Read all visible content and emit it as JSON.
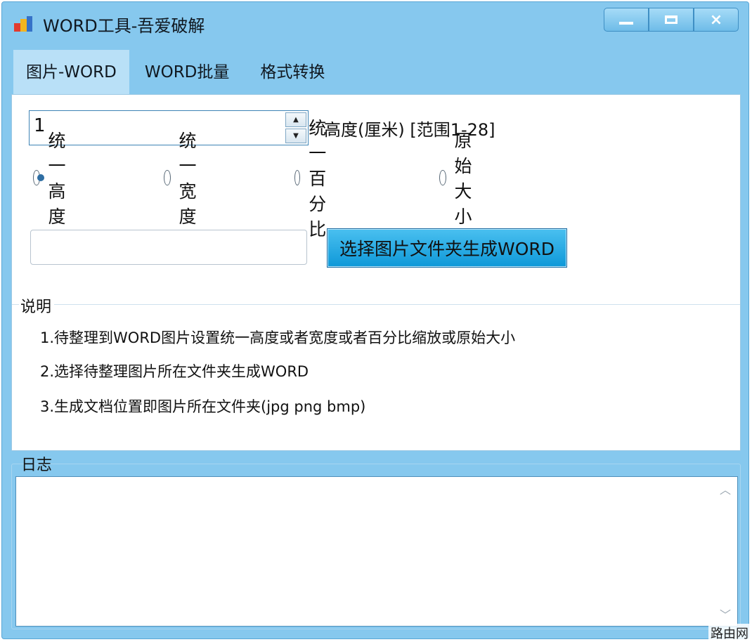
{
  "window": {
    "title": "WORD工具-吾爱破解",
    "icon": "word-app-icon",
    "controls": {
      "minimize": "minimize-icon",
      "maximize": "maximize-icon",
      "close": "×"
    }
  },
  "tabs": [
    {
      "label": "图片-WORD",
      "active": true
    },
    {
      "label": "WORD批量",
      "active": false
    },
    {
      "label": "格式转换",
      "active": false
    }
  ],
  "settings": {
    "height_value": "1",
    "height_label": "高度(厘米) [范围1-28]",
    "spin_up": "▲",
    "spin_down": "▼",
    "radios": [
      {
        "label": "统一高度",
        "checked": true
      },
      {
        "label": "统一宽度",
        "checked": false
      },
      {
        "label": "统一百分比",
        "checked": false
      },
      {
        "label": "原始大小",
        "checked": false
      }
    ],
    "path_value": "",
    "generate_button": "选择图片文件夹生成WORD"
  },
  "description": {
    "title": "说明",
    "items": [
      "1.待整理到WORD图片设置统一高度或者宽度或者百分比缩放或原始大小",
      "2.选择待整理图片所在文件夹生成WORD",
      "3.生成文档位置即图片所在文件夹(jpg png bmp)"
    ]
  },
  "log": {
    "title": "日志",
    "content": "",
    "scroll_up": "︿",
    "scroll_down": "﹀"
  },
  "watermark": "路由网",
  "colors": {
    "window_frame": "#86c8ee",
    "active_tab": "#b9e0f7",
    "button_accent": "#1aa3e0"
  }
}
